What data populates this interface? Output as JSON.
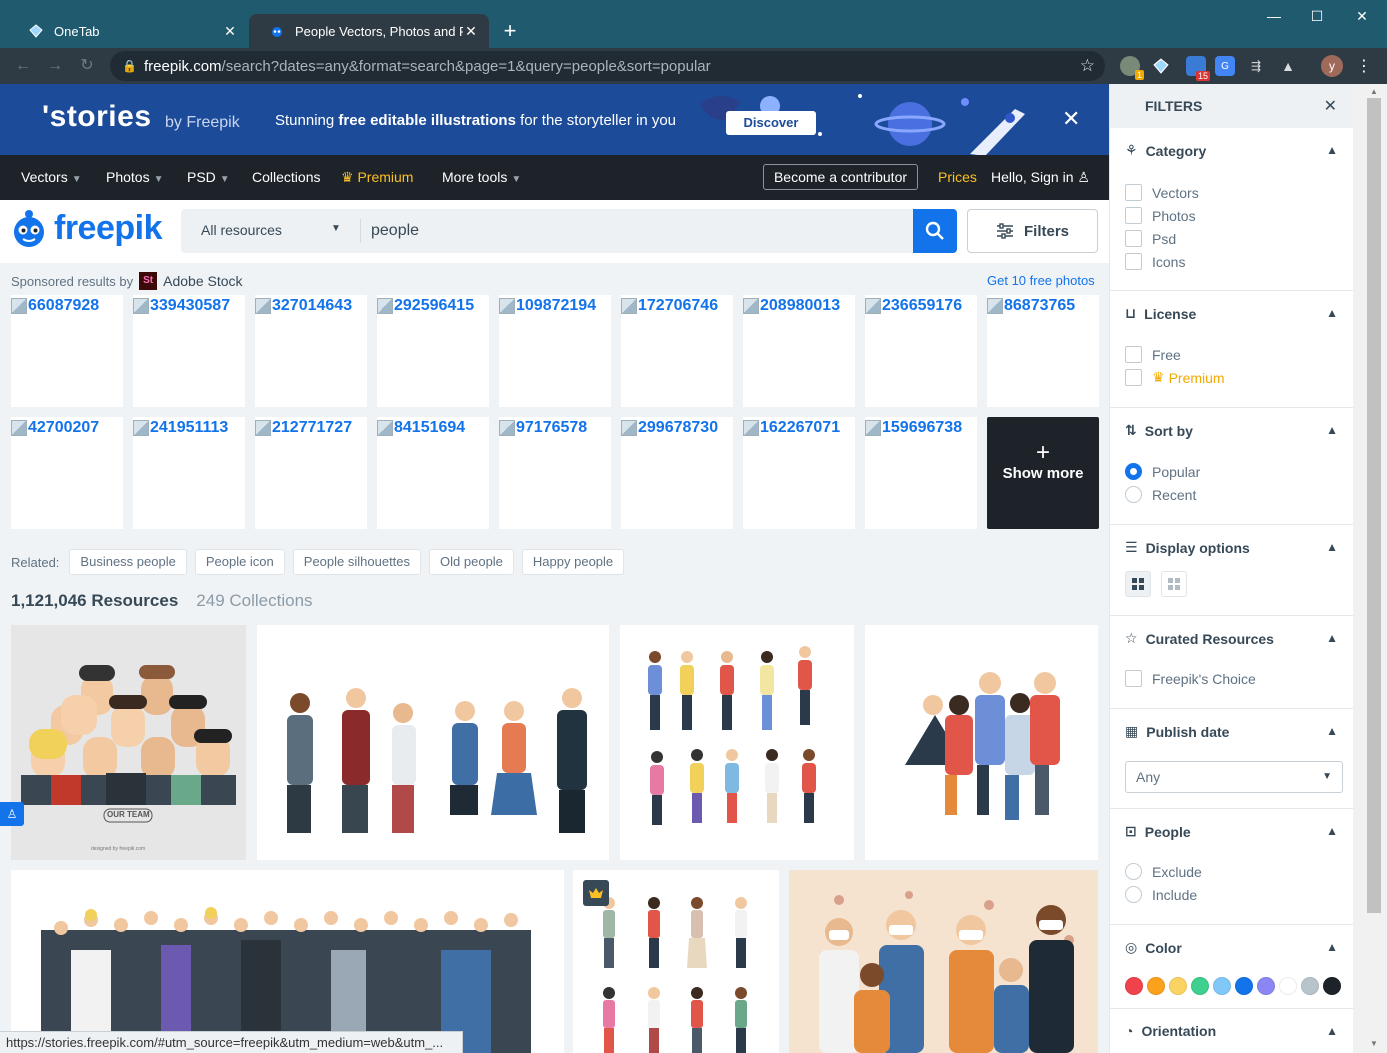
{
  "browser": {
    "tabs": [
      {
        "title": "OneTab",
        "close": "✕"
      },
      {
        "title": "People Vectors, Photos and PS",
        "close": ""
      }
    ],
    "new_tab": "+",
    "window_controls": {
      "minimize": "—",
      "maximize": "☐",
      "close": "✕"
    },
    "url_host": "freepik.com",
    "url_path": "/search?dates=any&format=search&page=1&query=people&sort=popular",
    "extension_badges": {
      "ext1": "1",
      "ext3": "15",
      "ext4": "G"
    },
    "profile_letter": "y",
    "status_url": "https://stories.freepik.com/#utm_source=freepik&utm_medium=web&utm_..."
  },
  "banner": {
    "logo": "'stories",
    "by": "by Freepik",
    "tagline_prefix": "Stunning ",
    "tagline_bold": "free editable illustrations",
    "tagline_suffix": " for the storyteller in you",
    "cta": "Discover",
    "close": "✕"
  },
  "nav": {
    "vectors": "Vectors",
    "photos": "Photos",
    "psd": "PSD",
    "collections": "Collections",
    "premium": "Premium",
    "more_tools": "More tools",
    "contributor": "Become a contributor",
    "prices": "Prices",
    "signin": "Hello, Sign in"
  },
  "search": {
    "logo": "freepik",
    "resource_type": "All resources",
    "query": "people",
    "filters_label": "Filters"
  },
  "sponsored": {
    "label": "Sponsored results by",
    "provider": "Adobe Stock",
    "get_free": "Get 10 free photos",
    "thumbs_row1": [
      "66087928",
      "339430587",
      "327014643",
      "292596415",
      "109872194",
      "172706746",
      "208980013",
      "236659176",
      "86873765"
    ],
    "thumbs_row2": [
      "42700207",
      "241951113",
      "212771727",
      "84151694",
      "97176578",
      "299678730",
      "162267071",
      "159696738"
    ],
    "show_more": "Show more"
  },
  "related": {
    "label": "Related:",
    "tags": [
      "Business people",
      "People icon",
      "People silhouettes",
      "Old people",
      "Happy people"
    ]
  },
  "results": {
    "resources": "1,121,046 Resources",
    "collections": "249 Collections",
    "our_team": "OUR TEAM",
    "credit": "designed by freepik.com"
  },
  "filters": {
    "title": "FILTERS",
    "category": {
      "title": "Category",
      "options": [
        "Vectors",
        "Photos",
        "Psd",
        "Icons"
      ]
    },
    "license": {
      "title": "License",
      "options": [
        "Free",
        "Premium"
      ]
    },
    "sort": {
      "title": "Sort by",
      "options": [
        "Popular",
        "Recent"
      ],
      "selected": "Popular"
    },
    "display": {
      "title": "Display options"
    },
    "curated": {
      "title": "Curated Resources",
      "options": [
        "Freepik's Choice"
      ]
    },
    "publish": {
      "title": "Publish date",
      "value": "Any"
    },
    "people": {
      "title": "People",
      "options": [
        "Exclude",
        "Include"
      ]
    },
    "color": {
      "title": "Color",
      "swatches": [
        "#f0424c",
        "#fba11b",
        "#fbd363",
        "#3fcf8e",
        "#7fc8f8",
        "#1273eb",
        "#8c86f5",
        "#ffffff",
        "#b8c4cc",
        "#1d2329"
      ]
    },
    "orientation": {
      "title": "Orientation"
    }
  },
  "colors": {
    "brand_blue": "#1273eb",
    "nav_dark": "#1d2329",
    "premium_gold": "#fcc025",
    "banner_blue": "#1c4b9a"
  }
}
